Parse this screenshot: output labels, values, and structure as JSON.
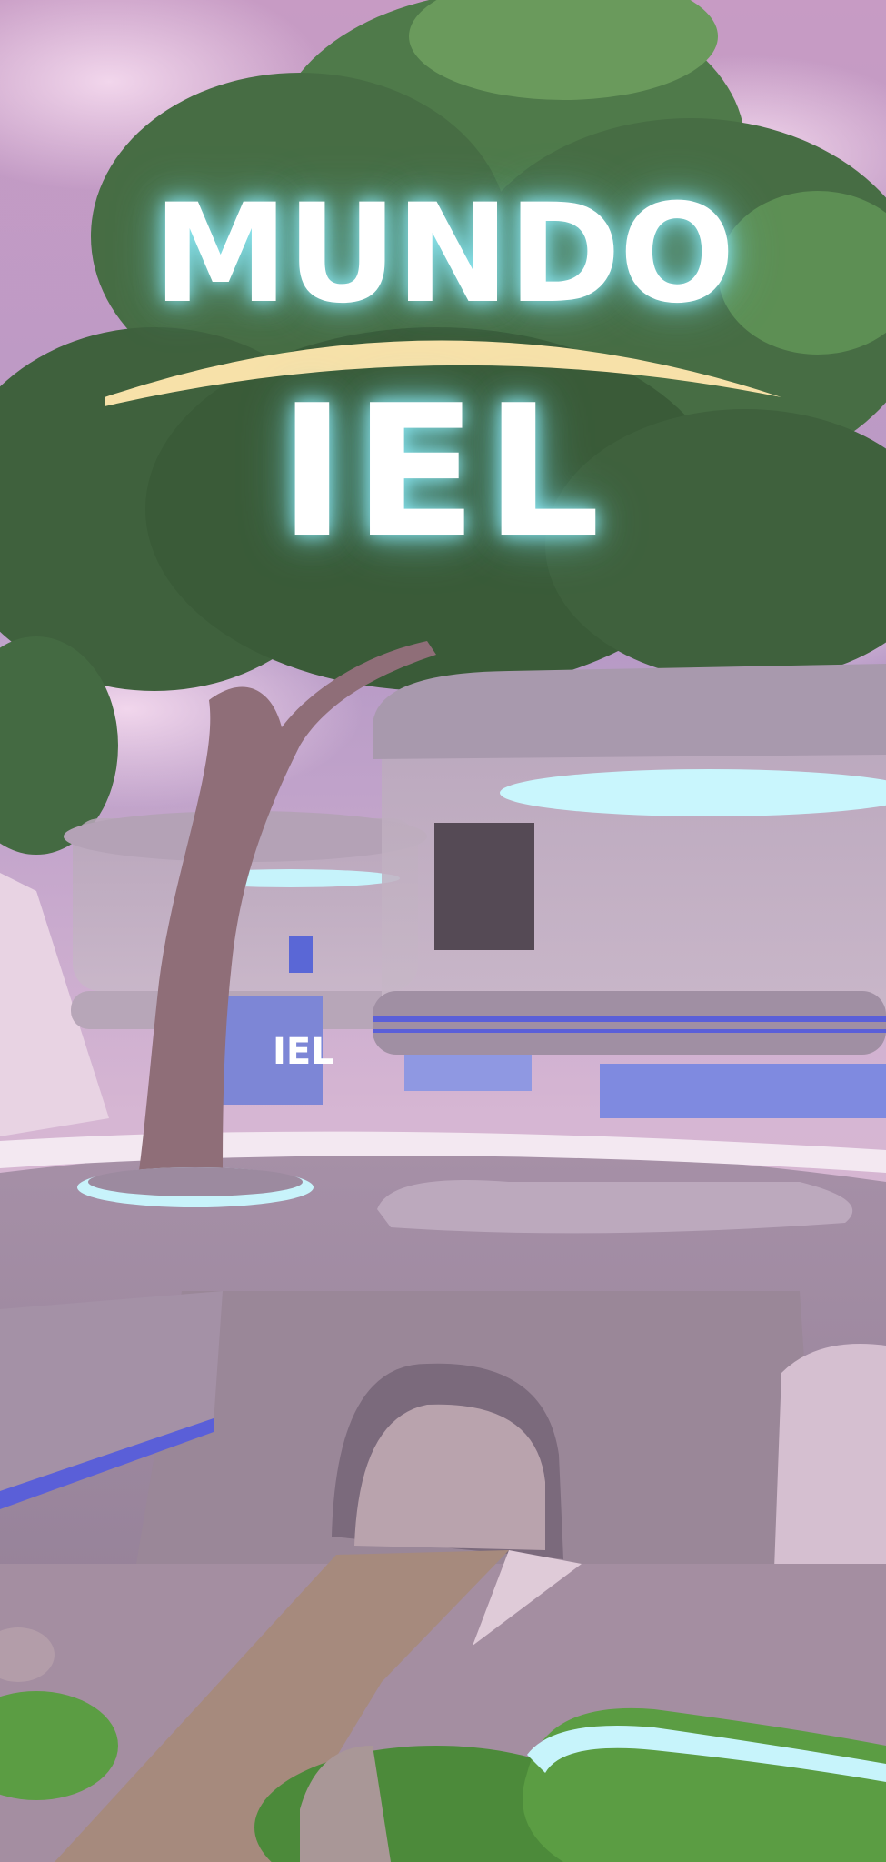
{
  "logo": {
    "line1": "MUNDO",
    "line2": "IEL"
  },
  "colors": {
    "sky": "#cfa6cf",
    "foliage": "#3f6f3c",
    "trunk": "#8f6e78",
    "glow": "#8fe6f0",
    "accent_stripe": "#5a5fd8",
    "arc": "#f7e1a9"
  },
  "scene": {
    "building_sign_text": "IEL"
  }
}
